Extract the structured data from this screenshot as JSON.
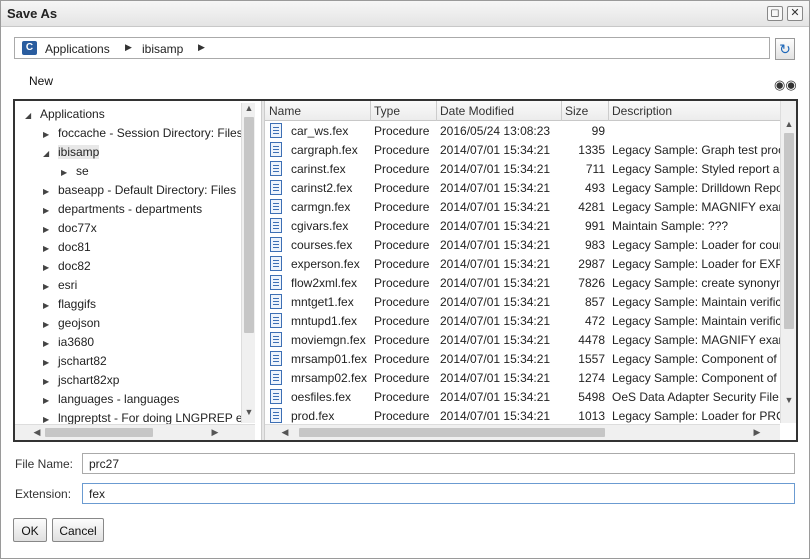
{
  "window": {
    "title": "Save As"
  },
  "breadcrumb": {
    "app_icon_letter": "C",
    "items": [
      "Applications",
      "ibisamp"
    ]
  },
  "toolbar": {
    "new_label": "New"
  },
  "tree": {
    "items": [
      {
        "label": "Applications",
        "expanded": true
      },
      {
        "label": "foccache - Session Directory: Files",
        "expanded": false
      },
      {
        "label": "ibisamp",
        "expanded": true,
        "selected": true
      },
      {
        "label": "se",
        "expanded": false
      },
      {
        "label": "baseapp - Default Directory: Files",
        "expanded": false
      },
      {
        "label": "departments - departments",
        "expanded": false
      },
      {
        "label": "doc77x",
        "expanded": false
      },
      {
        "label": "doc81",
        "expanded": false
      },
      {
        "label": "doc82",
        "expanded": false
      },
      {
        "label": "esri",
        "expanded": false
      },
      {
        "label": "flaggifs",
        "expanded": false
      },
      {
        "label": "geojson",
        "expanded": false
      },
      {
        "label": "ia3680",
        "expanded": false
      },
      {
        "label": "jschart82",
        "expanded": false
      },
      {
        "label": "jschart82xp",
        "expanded": false
      },
      {
        "label": "languages - languages",
        "expanded": false
      },
      {
        "label": "lngpreptst - For doing LNGPREP ex",
        "expanded": false
      }
    ]
  },
  "grid": {
    "columns": [
      "Name",
      "Type",
      "Date Modified",
      "Size",
      "Description"
    ],
    "rows": [
      [
        "car_ws.fex",
        "Procedure",
        "2016/05/24 13:08:23",
        "99",
        ""
      ],
      [
        "cargraph.fex",
        "Procedure",
        "2014/07/01 15:34:21",
        "1335",
        "Legacy Sample: Graph test proc"
      ],
      [
        "carinst.fex",
        "Procedure",
        "2014/07/01 15:34:21",
        "711",
        "Legacy Sample: Styled report a"
      ],
      [
        "carinst2.fex",
        "Procedure",
        "2014/07/01 15:34:21",
        "493",
        "Legacy Sample: Drilldown Repo"
      ],
      [
        "carmgn.fex",
        "Procedure",
        "2014/07/01 15:34:21",
        "4281",
        "Legacy Sample: MAGNIFY exam"
      ],
      [
        "cgivars.fex",
        "Procedure",
        "2014/07/01 15:34:21",
        "991",
        "Maintain Sample: ???"
      ],
      [
        "courses.fex",
        "Procedure",
        "2014/07/01 15:34:21",
        "983",
        "Legacy Sample: Loader for cour"
      ],
      [
        "experson.fex",
        "Procedure",
        "2014/07/01 15:34:21",
        "2987",
        "Legacy Sample: Loader for EXP"
      ],
      [
        "flow2xml.fex",
        "Procedure",
        "2014/07/01 15:34:21",
        "7826",
        "Legacy Sample: create synonym"
      ],
      [
        "mntget1.fex",
        "Procedure",
        "2014/07/01 15:34:21",
        "857",
        "Legacy Sample: Maintain verific"
      ],
      [
        "mntupd1.fex",
        "Procedure",
        "2014/07/01 15:34:21",
        "472",
        "Legacy Sample: Maintain verific"
      ],
      [
        "moviemgn.fex",
        "Procedure",
        "2014/07/01 15:34:21",
        "4478",
        "Legacy Sample: MAGNIFY exam"
      ],
      [
        "mrsamp01.fex",
        "Procedure",
        "2014/07/01 15:34:21",
        "1557",
        "Legacy Sample: Component of I"
      ],
      [
        "mrsamp02.fex",
        "Procedure",
        "2014/07/01 15:34:21",
        "1274",
        "Legacy Sample: Component of I"
      ],
      [
        "oesfiles.fex",
        "Procedure",
        "2014/07/01 15:34:21",
        "5498",
        "OeS Data Adapter Security File"
      ],
      [
        "prod.fex",
        "Procedure",
        "2014/07/01 15:34:21",
        "1013",
        "Legacy Sample: Loader for PRO"
      ]
    ]
  },
  "form": {
    "file_name_label": "File Name:",
    "file_name_value": "prc27",
    "extension_label": "Extension:",
    "extension_value": "fex"
  },
  "buttons": {
    "ok": "OK",
    "cancel": "Cancel"
  },
  "icons": {
    "restore": "restore-icon",
    "close": "close-icon",
    "refresh": "refresh-icon",
    "search": "binoculars-icon",
    "file": "document-icon"
  },
  "colors": {
    "accent": "#2a5d9f",
    "refresh": "#1c66b8",
    "focus_border": "#6b9bd1"
  }
}
